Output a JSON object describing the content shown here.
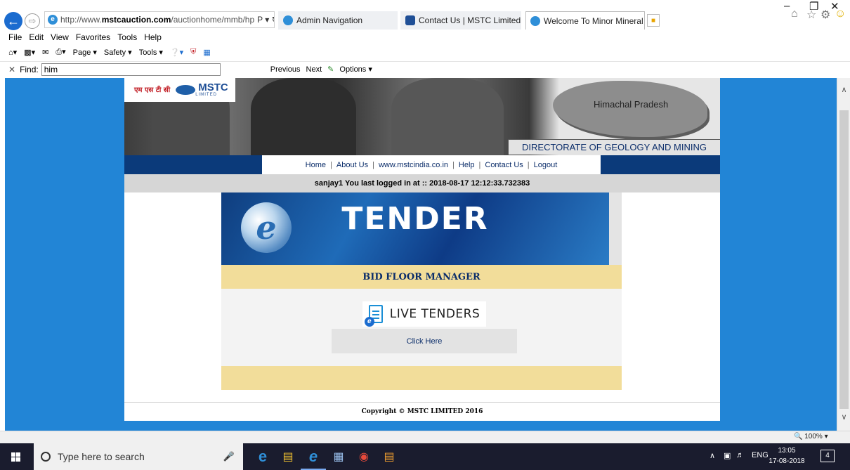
{
  "browser": {
    "address": {
      "prefix": "http://www.",
      "host": "mstcauction.com",
      "path": "/auctionhome/mmb/hp",
      "tools": "Ρ ▾ ↻"
    },
    "tabs": [
      {
        "label": "Admin Navigation"
      },
      {
        "label": "Contact Us | MSTC Limited"
      },
      {
        "label": "Welcome To Minor Mineral ...",
        "close": "✕"
      }
    ],
    "menu": [
      "File",
      "Edit",
      "View",
      "Favorites",
      "Tools",
      "Help"
    ],
    "command_bar": [
      "Page ▾",
      "Safety ▾",
      "Tools ▾"
    ],
    "find": {
      "label": "Find:",
      "value": "him",
      "previous": "Previous",
      "next": "Next",
      "options": "Options ▾"
    },
    "zoom": "100%"
  },
  "site": {
    "logo": {
      "hindi": "एम एस टी सी",
      "name": "MSTC",
      "sub": "LIMITED"
    },
    "state": "Himachal Pradesh",
    "department": "DIRECTORATE OF GEOLOGY AND MINING",
    "nav": [
      "Home",
      "About Us",
      "www.mstcindia.co.in",
      "Help",
      "Contact Us",
      "Logout"
    ],
    "login_info": "sanjay1  You last logged in at :: 2018-08-17 12:12:33.732383",
    "tender_title": "TENDER",
    "bid_floor": "BID FLOOR MANAGER",
    "live_tenders": "LIVE TENDERS",
    "click_here": "Click Here",
    "copyright": "Copyright © MSTC LIMITED 2016"
  },
  "taskbar": {
    "search_placeholder": "Type here to search",
    "language": "ENG",
    "time": "13:05",
    "date": "17-08-2018",
    "notifications": "4"
  }
}
